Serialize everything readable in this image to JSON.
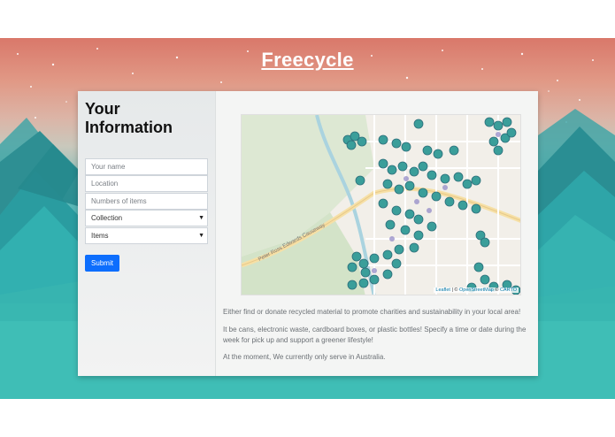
{
  "header": {
    "title": "Freecycle"
  },
  "form": {
    "title": "Your Information",
    "name_placeholder": "Your name",
    "location_placeholder": "Location",
    "items_count_placeholder": "Numbers of items",
    "collection_select": "Collection",
    "items_select": "Items",
    "submit_label": "Submit"
  },
  "map": {
    "attribution": {
      "leaflet": "Leaflet",
      "sep1": " | © ",
      "osm": "OpenStreetMap",
      "sep2": " © ",
      "carto": "CARTO"
    },
    "road_label": "Peter Ross Edwards Causeway",
    "marker_color": "#3a9e9a"
  },
  "content": {
    "para1": "Either find or donate recycled material to promote charities and sustainability in your local area!",
    "para2": "It be cans, electronic waste, cardboard boxes, or plastic bottles! Specify a time or date during the week for pick up and support a greener lifestyle!",
    "para3": "At the moment, We currently only serve in Australia."
  }
}
